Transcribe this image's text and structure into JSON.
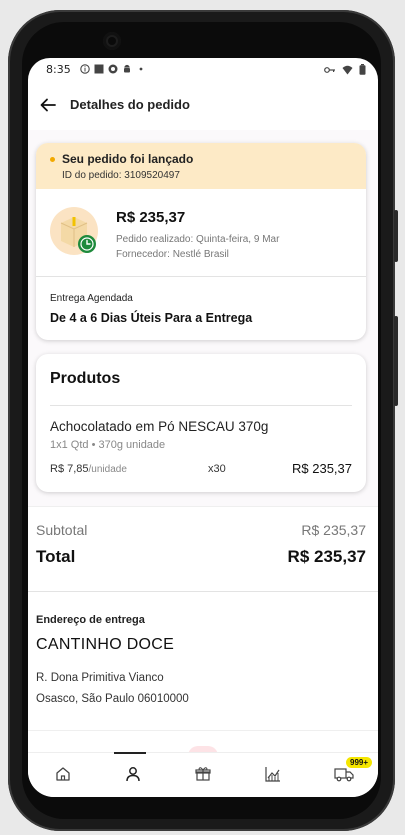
{
  "status_bar": {
    "time": "8:35"
  },
  "header": {
    "title": "Detalhes do pedido"
  },
  "order": {
    "status_title": "Seu pedido foi lançado",
    "order_id": "ID do pedido: 3109520497",
    "price": "R$ 235,37",
    "placed_on": "Pedido realizado: Quinta-feira, 9 Mar",
    "supplier": "Fornecedor: Nestlé Brasil",
    "delivery_label": "Entrega Agendada",
    "delivery_value": "De 4 a 6 Dias Úteis Para a Entrega"
  },
  "products": {
    "title": "Produtos",
    "items": [
      {
        "name": "Achocolatado em Pó NESCAU 370g",
        "qty_info": "1x1 Qtd • 370g unidade",
        "unit_price": "R$ 7,85",
        "unit_suffix": "/unidade",
        "count": "x30",
        "total": "R$ 235,37"
      }
    ]
  },
  "summary": {
    "subtotal_label": "Subtotal",
    "subtotal_value": "R$ 235,37",
    "total_label": "Total",
    "total_value": "R$ 235,37"
  },
  "address": {
    "label": "Endereço de entrega",
    "name": "CANTINHO DOCE",
    "line1": "R. Dona Primitiva Vianco",
    "line2": "Osasco, São Paulo 06010000"
  },
  "bottom_nav": {
    "items": [
      "home-icon",
      "profile-icon",
      "gift-icon",
      "chart-icon",
      "truck-icon"
    ],
    "active": "profile-icon",
    "badge": "999+"
  },
  "colors": {
    "banner_bg": "#fdeac6",
    "bullet": "#f2a900",
    "badge": "#f5e600",
    "clock_badge": "#1e8a3c"
  }
}
